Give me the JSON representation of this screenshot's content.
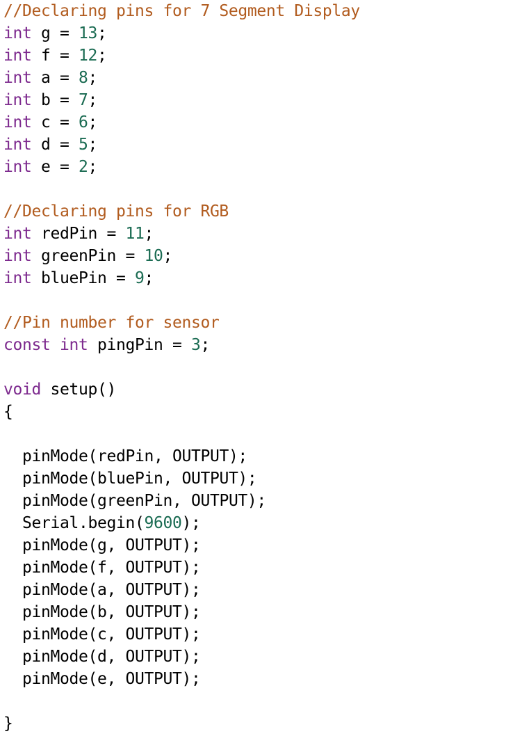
{
  "document": {
    "kind": "source-code-listing",
    "language": "Arduino C++",
    "background_color": "#ffffff"
  },
  "syntax_colors": {
    "comment": "#b15b1e",
    "keyword": "#7d2a8e",
    "number": "#1a6b52",
    "plain": "#000000"
  },
  "code": {
    "lines": [
      {
        "indent": 0,
        "tokens": [
          {
            "t": "comment",
            "s": "//Declaring pins for 7 Segment Display"
          }
        ]
      },
      {
        "indent": 0,
        "tokens": [
          {
            "t": "keyword",
            "s": "int"
          },
          {
            "t": "plain",
            "s": " g = "
          },
          {
            "t": "number",
            "s": "13"
          },
          {
            "t": "plain",
            "s": ";"
          }
        ]
      },
      {
        "indent": 0,
        "tokens": [
          {
            "t": "keyword",
            "s": "int"
          },
          {
            "t": "plain",
            "s": " f = "
          },
          {
            "t": "number",
            "s": "12"
          },
          {
            "t": "plain",
            "s": ";"
          }
        ]
      },
      {
        "indent": 0,
        "tokens": [
          {
            "t": "keyword",
            "s": "int"
          },
          {
            "t": "plain",
            "s": " a = "
          },
          {
            "t": "number",
            "s": "8"
          },
          {
            "t": "plain",
            "s": ";"
          }
        ]
      },
      {
        "indent": 0,
        "tokens": [
          {
            "t": "keyword",
            "s": "int"
          },
          {
            "t": "plain",
            "s": " b = "
          },
          {
            "t": "number",
            "s": "7"
          },
          {
            "t": "plain",
            "s": ";"
          }
        ]
      },
      {
        "indent": 0,
        "tokens": [
          {
            "t": "keyword",
            "s": "int"
          },
          {
            "t": "plain",
            "s": " c = "
          },
          {
            "t": "number",
            "s": "6"
          },
          {
            "t": "plain",
            "s": ";"
          }
        ]
      },
      {
        "indent": 0,
        "tokens": [
          {
            "t": "keyword",
            "s": "int"
          },
          {
            "t": "plain",
            "s": " d = "
          },
          {
            "t": "number",
            "s": "5"
          },
          {
            "t": "plain",
            "s": ";"
          }
        ]
      },
      {
        "indent": 0,
        "tokens": [
          {
            "t": "keyword",
            "s": "int"
          },
          {
            "t": "plain",
            "s": " e = "
          },
          {
            "t": "number",
            "s": "2"
          },
          {
            "t": "plain",
            "s": ";"
          }
        ]
      },
      {
        "indent": 0,
        "tokens": []
      },
      {
        "indent": 0,
        "tokens": [
          {
            "t": "comment",
            "s": "//Declaring pins for RGB"
          }
        ]
      },
      {
        "indent": 0,
        "tokens": [
          {
            "t": "keyword",
            "s": "int"
          },
          {
            "t": "plain",
            "s": " redPin = "
          },
          {
            "t": "number",
            "s": "11"
          },
          {
            "t": "plain",
            "s": ";"
          }
        ]
      },
      {
        "indent": 0,
        "tokens": [
          {
            "t": "keyword",
            "s": "int"
          },
          {
            "t": "plain",
            "s": " greenPin = "
          },
          {
            "t": "number",
            "s": "10"
          },
          {
            "t": "plain",
            "s": ";"
          }
        ]
      },
      {
        "indent": 0,
        "tokens": [
          {
            "t": "keyword",
            "s": "int"
          },
          {
            "t": "plain",
            "s": " bluePin = "
          },
          {
            "t": "number",
            "s": "9"
          },
          {
            "t": "plain",
            "s": ";"
          }
        ]
      },
      {
        "indent": 0,
        "tokens": []
      },
      {
        "indent": 0,
        "tokens": [
          {
            "t": "comment",
            "s": "//Pin number for sensor"
          }
        ]
      },
      {
        "indent": 0,
        "tokens": [
          {
            "t": "keyword",
            "s": "const int"
          },
          {
            "t": "plain",
            "s": " pingPin = "
          },
          {
            "t": "number",
            "s": "3"
          },
          {
            "t": "plain",
            "s": ";"
          }
        ]
      },
      {
        "indent": 0,
        "tokens": []
      },
      {
        "indent": 0,
        "tokens": [
          {
            "t": "keyword",
            "s": "void"
          },
          {
            "t": "plain",
            "s": " setup()"
          }
        ]
      },
      {
        "indent": 0,
        "tokens": [
          {
            "t": "plain",
            "s": "{"
          }
        ]
      },
      {
        "indent": 0,
        "tokens": []
      },
      {
        "indent": 2,
        "tokens": [
          {
            "t": "plain",
            "s": "pinMode(redPin, OUTPUT);"
          }
        ]
      },
      {
        "indent": 2,
        "tokens": [
          {
            "t": "plain",
            "s": "pinMode(bluePin, OUTPUT);"
          }
        ]
      },
      {
        "indent": 2,
        "tokens": [
          {
            "t": "plain",
            "s": "pinMode(greenPin, OUTPUT);"
          }
        ]
      },
      {
        "indent": 2,
        "tokens": [
          {
            "t": "plain",
            "s": "Serial.begin("
          },
          {
            "t": "number",
            "s": "9600"
          },
          {
            "t": "plain",
            "s": ");"
          }
        ]
      },
      {
        "indent": 2,
        "tokens": [
          {
            "t": "plain",
            "s": "pinMode(g, OUTPUT);"
          }
        ]
      },
      {
        "indent": 2,
        "tokens": [
          {
            "t": "plain",
            "s": "pinMode(f, OUTPUT);"
          }
        ]
      },
      {
        "indent": 2,
        "tokens": [
          {
            "t": "plain",
            "s": "pinMode(a, OUTPUT);"
          }
        ]
      },
      {
        "indent": 2,
        "tokens": [
          {
            "t": "plain",
            "s": "pinMode(b, OUTPUT);"
          }
        ]
      },
      {
        "indent": 2,
        "tokens": [
          {
            "t": "plain",
            "s": "pinMode(c, OUTPUT);"
          }
        ]
      },
      {
        "indent": 2,
        "tokens": [
          {
            "t": "plain",
            "s": "pinMode(d, OUTPUT);"
          }
        ]
      },
      {
        "indent": 2,
        "tokens": [
          {
            "t": "plain",
            "s": "pinMode(e, OUTPUT);"
          }
        ]
      },
      {
        "indent": 0,
        "tokens": []
      },
      {
        "indent": 0,
        "tokens": [
          {
            "t": "plain",
            "s": "}"
          }
        ]
      }
    ]
  }
}
